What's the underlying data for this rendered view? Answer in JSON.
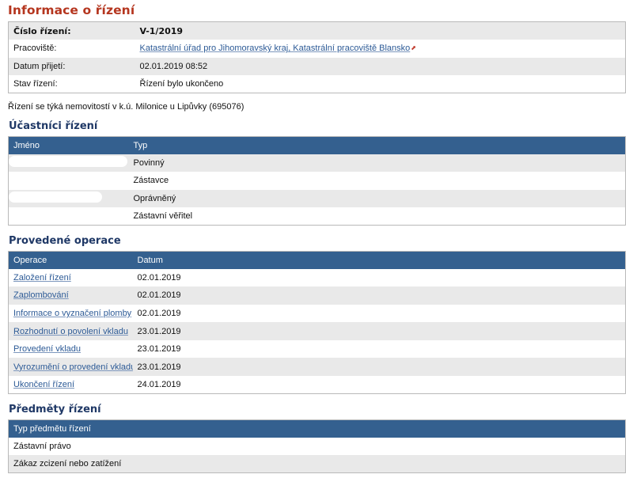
{
  "title": "Informace o řízení",
  "info": {
    "rows": [
      {
        "label": "Číslo řízení:",
        "value": "V-1/2019"
      },
      {
        "label": "Pracoviště:",
        "value": "Katastrální úřad pro Jihomoravský kraj, Katastrální pracoviště Blansko"
      },
      {
        "label": "Datum přijetí:",
        "value": "02.01.2019 08:52"
      },
      {
        "label": "Stav řízení:",
        "value": "Řízení bylo ukončeno"
      }
    ]
  },
  "note": "Řízení se týká nemovitostí v k.ú. Milonice u Lipůvky (695076)",
  "participants": {
    "heading": "Účastníci řízení",
    "columns": {
      "name": "Jméno",
      "type": "Typ"
    },
    "rows": [
      {
        "type": "Povinný"
      },
      {
        "type": "Zástavce"
      },
      {
        "type": "Oprávněný"
      },
      {
        "type": "Zástavní věřitel"
      }
    ]
  },
  "operations": {
    "heading": "Provedené operace",
    "columns": {
      "operation": "Operace",
      "date": "Datum"
    },
    "rows": [
      {
        "operation": "Založení řízení",
        "date": "02.01.2019"
      },
      {
        "operation": "Zaplombování",
        "date": "02.01.2019"
      },
      {
        "operation": "Informace o vyznačení plomby",
        "date": "02.01.2019"
      },
      {
        "operation": "Rozhodnutí o povolení vkladu",
        "date": "23.01.2019"
      },
      {
        "operation": "Provedení vkladu",
        "date": "23.01.2019"
      },
      {
        "operation": "Vyrozumění o provedení vkladu",
        "date": "23.01.2019"
      },
      {
        "operation": "Ukončení řízení",
        "date": "24.01.2019"
      }
    ]
  },
  "subjects": {
    "heading": "Předměty řízení",
    "columns": {
      "type": "Typ předmětu řízení"
    },
    "rows": [
      {
        "type": "Zástavní právo"
      },
      {
        "type": "Zákaz zcizení nebo zatížení"
      }
    ]
  },
  "icons": {
    "external_link": "external-link-icon"
  },
  "colors": {
    "title": "#b5361f",
    "heading": "#1f3866",
    "table_header": "#34608f",
    "link": "#2c5a96",
    "row_alt": "#e9e9e9"
  }
}
